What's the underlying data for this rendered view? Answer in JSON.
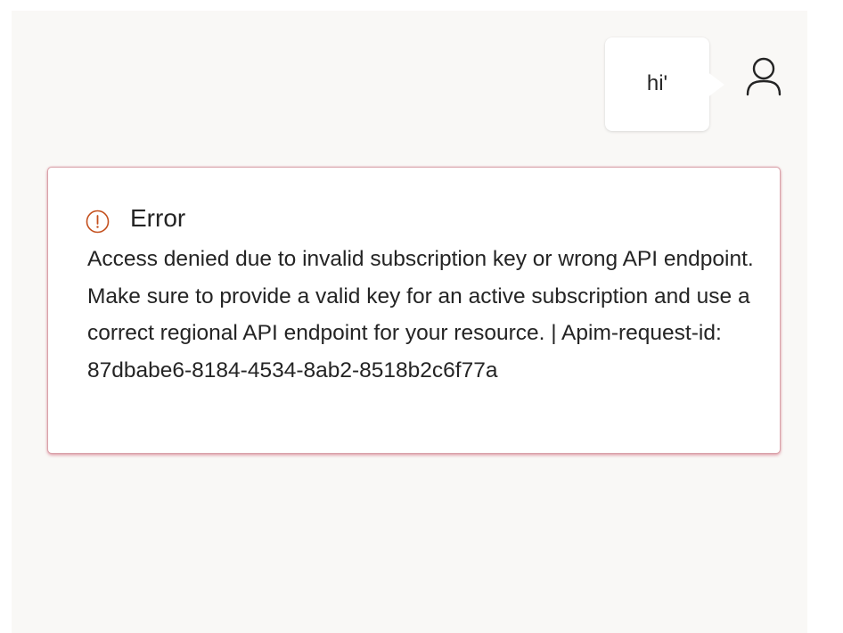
{
  "chat": {
    "message": "hi'",
    "avatar_icon": "person-icon"
  },
  "error": {
    "icon": "error-circle-icon",
    "title": "Error",
    "message": "Access denied due to invalid subscription key or wrong API endpoint. Make sure to provide a valid key for an active subscription and use a correct regional API endpoint for your resource. | Apim-request-id: 87dbabe6-8184-4534-8ab2-8518b2c6f77a"
  },
  "colors": {
    "error_accent": "#c4314b",
    "error_icon": "#c4501e",
    "canvas_bg": "#f9f8f6"
  }
}
